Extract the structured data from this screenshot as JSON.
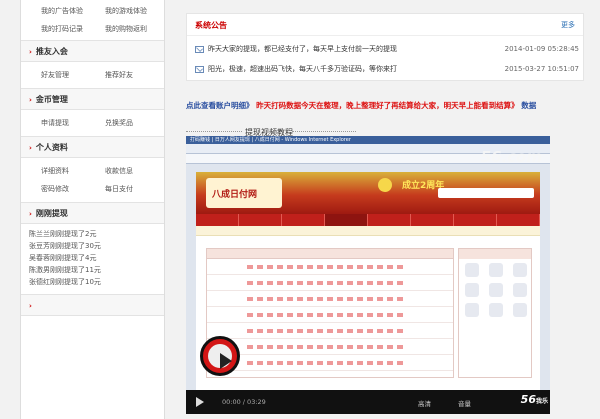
{
  "sidebar": {
    "top_links": [
      "我的广告体验",
      "我的游戏体验",
      "我的打码记录",
      "我的购物返利"
    ],
    "sections": [
      {
        "title": "推友入会",
        "links": [
          "好友管理",
          "推荐好友"
        ]
      },
      {
        "title": "金币管理",
        "links": [
          "申请提现",
          "兑换奖品"
        ]
      },
      {
        "title": "个人资料",
        "links": [
          "详细资料",
          "收款信息",
          "密码修改",
          "每日支付"
        ]
      }
    ],
    "feed_title": "刚刚提现",
    "feed": [
      "陈兰兰刚刚提现了2元",
      "张豆芳刚刚提现了30元",
      "吴春蓉刚刚提现了4元",
      "陈激男刚刚提现了11元",
      "张德红刚刚提现了10元"
    ],
    "bottom_arrow": "›"
  },
  "notice": {
    "title": "系统公告",
    "more": "更多",
    "items": [
      {
        "text": "昨天大家的提现，都已经支付了，每天早上支付前一天的提现",
        "date": "2014-01-09 05:28:45"
      },
      {
        "text": "阳光，极速，超速出码飞快，每天八千多万验证码，等你来打",
        "date": "2015-03-27 10:51:07"
      }
    ]
  },
  "marquee": {
    "part1": "点此查看账户明细》",
    "part2": "昨天打码数据今天在整理，晚上整理好了再结算给大家，明天早上能看到结算》",
    "part3": "数据"
  },
  "video": {
    "title": "提现视频教程",
    "screen_title": "打码赚钱 | 日万人网友提现 | 八成日付网 - Windows Internet Explorer",
    "site_name": "八成日付网",
    "anniversary": "成立2周年",
    "watermark": "56.com",
    "time": "00:00 / 03:29",
    "hd": "高清",
    "vol": "音量",
    "brand": "56",
    "brand_sub": "我乐"
  },
  "colors": {
    "accent": "#cc0000",
    "link": "#2a6fb4"
  }
}
